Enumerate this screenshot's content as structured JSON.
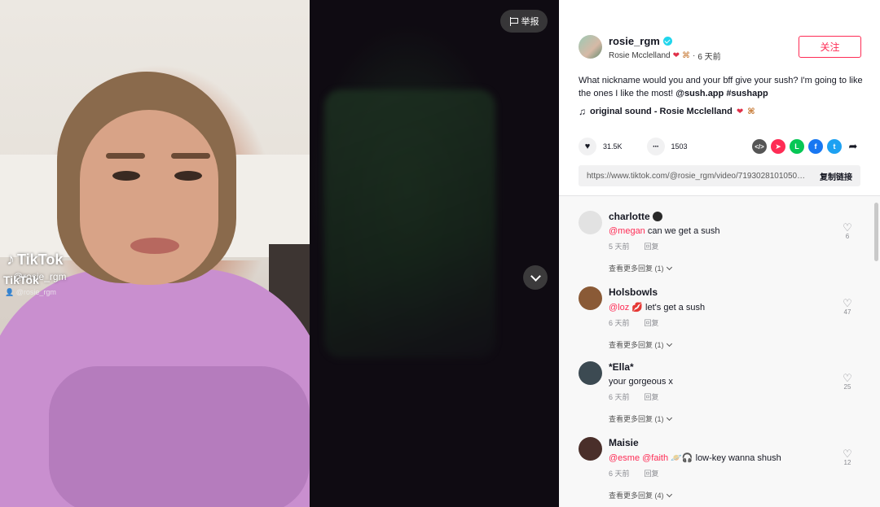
{
  "video": {
    "watermark_brand": "TikTok",
    "watermark_handle": "@rosie_rgm",
    "watermark_brand_2": "TikTok",
    "watermark_small": "@rosie_rgm",
    "report_label": "举报"
  },
  "author": {
    "username": "rosie_rgm",
    "display_name": "Rosie Mcclelland",
    "time_ago": "6 天前",
    "separator": "·",
    "follow_label": "关注"
  },
  "post": {
    "caption": "What nickname would you and your bff give your sush? I'm going to like the ones I like the most!",
    "tag_1": "@sush.app",
    "tag_2": "#sushapp",
    "sound": "original sound - Rosie Mcclelland",
    "likes": "31.5K",
    "comments_count": "1503",
    "link": "https://www.tiktok.com/@rosie_rgm/video/7193028101050289434",
    "copy_link_label": "复制链接"
  },
  "comments": [
    {
      "name": "charlotte",
      "mention": "@megan",
      "text": " can we get a sush",
      "time": "5 天前",
      "reply": "回复",
      "more": "查看更多回复 (1)",
      "likes": "6",
      "avatar_color": "#d8d8d8"
    },
    {
      "name": "Holsbowls",
      "mention": "@loz",
      "text": " let's get a sush",
      "time": "6 天前",
      "reply": "回复",
      "more": "查看更多回复 (1)",
      "likes": "47",
      "avatar_color": "#8a5a36"
    },
    {
      "name": "*Ella*",
      "mention": "",
      "text": "your gorgeous x",
      "time": "6 天前",
      "reply": "回复",
      "more": "查看更多回复 (1)",
      "likes": "25",
      "avatar_color": "#3c4a52"
    },
    {
      "name": "Maisie",
      "mention": "@esme @faith",
      "text": " low-key wanna shush",
      "time": "6 天前",
      "reply": "回复",
      "more": "查看更多回复 (4)",
      "likes": "12",
      "avatar_color": "#4a2f2a"
    }
  ]
}
